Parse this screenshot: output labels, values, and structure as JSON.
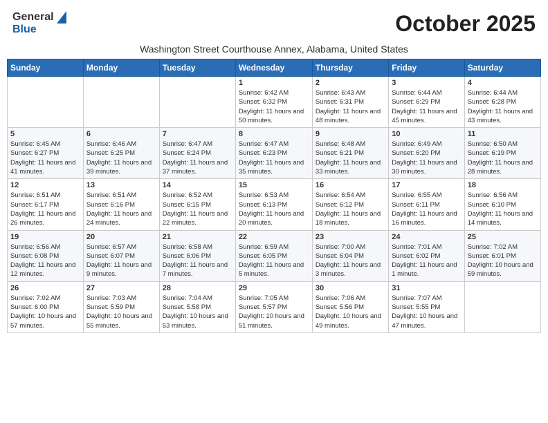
{
  "header": {
    "logo_general": "General",
    "logo_blue": "Blue",
    "month_title": "October 2025",
    "subtitle": "Washington Street Courthouse Annex, Alabama, United States"
  },
  "weekdays": [
    "Sunday",
    "Monday",
    "Tuesday",
    "Wednesday",
    "Thursday",
    "Friday",
    "Saturday"
  ],
  "weeks": [
    [
      {
        "day": "",
        "info": ""
      },
      {
        "day": "",
        "info": ""
      },
      {
        "day": "",
        "info": ""
      },
      {
        "day": "1",
        "info": "Sunrise: 6:42 AM\nSunset: 6:32 PM\nDaylight: 11 hours and 50 minutes."
      },
      {
        "day": "2",
        "info": "Sunrise: 6:43 AM\nSunset: 6:31 PM\nDaylight: 11 hours and 48 minutes."
      },
      {
        "day": "3",
        "info": "Sunrise: 6:44 AM\nSunset: 6:29 PM\nDaylight: 11 hours and 45 minutes."
      },
      {
        "day": "4",
        "info": "Sunrise: 6:44 AM\nSunset: 6:28 PM\nDaylight: 11 hours and 43 minutes."
      }
    ],
    [
      {
        "day": "5",
        "info": "Sunrise: 6:45 AM\nSunset: 6:27 PM\nDaylight: 11 hours and 41 minutes."
      },
      {
        "day": "6",
        "info": "Sunrise: 6:46 AM\nSunset: 6:25 PM\nDaylight: 11 hours and 39 minutes."
      },
      {
        "day": "7",
        "info": "Sunrise: 6:47 AM\nSunset: 6:24 PM\nDaylight: 11 hours and 37 minutes."
      },
      {
        "day": "8",
        "info": "Sunrise: 6:47 AM\nSunset: 6:23 PM\nDaylight: 11 hours and 35 minutes."
      },
      {
        "day": "9",
        "info": "Sunrise: 6:48 AM\nSunset: 6:21 PM\nDaylight: 11 hours and 33 minutes."
      },
      {
        "day": "10",
        "info": "Sunrise: 6:49 AM\nSunset: 6:20 PM\nDaylight: 11 hours and 30 minutes."
      },
      {
        "day": "11",
        "info": "Sunrise: 6:50 AM\nSunset: 6:19 PM\nDaylight: 11 hours and 28 minutes."
      }
    ],
    [
      {
        "day": "12",
        "info": "Sunrise: 6:51 AM\nSunset: 6:17 PM\nDaylight: 11 hours and 26 minutes."
      },
      {
        "day": "13",
        "info": "Sunrise: 6:51 AM\nSunset: 6:16 PM\nDaylight: 11 hours and 24 minutes."
      },
      {
        "day": "14",
        "info": "Sunrise: 6:52 AM\nSunset: 6:15 PM\nDaylight: 11 hours and 22 minutes."
      },
      {
        "day": "15",
        "info": "Sunrise: 6:53 AM\nSunset: 6:13 PM\nDaylight: 11 hours and 20 minutes."
      },
      {
        "day": "16",
        "info": "Sunrise: 6:54 AM\nSunset: 6:12 PM\nDaylight: 11 hours and 18 minutes."
      },
      {
        "day": "17",
        "info": "Sunrise: 6:55 AM\nSunset: 6:11 PM\nDaylight: 11 hours and 16 minutes."
      },
      {
        "day": "18",
        "info": "Sunrise: 6:56 AM\nSunset: 6:10 PM\nDaylight: 11 hours and 14 minutes."
      }
    ],
    [
      {
        "day": "19",
        "info": "Sunrise: 6:56 AM\nSunset: 6:08 PM\nDaylight: 11 hours and 12 minutes."
      },
      {
        "day": "20",
        "info": "Sunrise: 6:57 AM\nSunset: 6:07 PM\nDaylight: 11 hours and 9 minutes."
      },
      {
        "day": "21",
        "info": "Sunrise: 6:58 AM\nSunset: 6:06 PM\nDaylight: 11 hours and 7 minutes."
      },
      {
        "day": "22",
        "info": "Sunrise: 6:59 AM\nSunset: 6:05 PM\nDaylight: 11 hours and 5 minutes."
      },
      {
        "day": "23",
        "info": "Sunrise: 7:00 AM\nSunset: 6:04 PM\nDaylight: 11 hours and 3 minutes."
      },
      {
        "day": "24",
        "info": "Sunrise: 7:01 AM\nSunset: 6:02 PM\nDaylight: 11 hours and 1 minute."
      },
      {
        "day": "25",
        "info": "Sunrise: 7:02 AM\nSunset: 6:01 PM\nDaylight: 10 hours and 59 minutes."
      }
    ],
    [
      {
        "day": "26",
        "info": "Sunrise: 7:02 AM\nSunset: 6:00 PM\nDaylight: 10 hours and 57 minutes."
      },
      {
        "day": "27",
        "info": "Sunrise: 7:03 AM\nSunset: 5:59 PM\nDaylight: 10 hours and 55 minutes."
      },
      {
        "day": "28",
        "info": "Sunrise: 7:04 AM\nSunset: 5:58 PM\nDaylight: 10 hours and 53 minutes."
      },
      {
        "day": "29",
        "info": "Sunrise: 7:05 AM\nSunset: 5:57 PM\nDaylight: 10 hours and 51 minutes."
      },
      {
        "day": "30",
        "info": "Sunrise: 7:06 AM\nSunset: 5:56 PM\nDaylight: 10 hours and 49 minutes."
      },
      {
        "day": "31",
        "info": "Sunrise: 7:07 AM\nSunset: 5:55 PM\nDaylight: 10 hours and 47 minutes."
      },
      {
        "day": "",
        "info": ""
      }
    ]
  ]
}
